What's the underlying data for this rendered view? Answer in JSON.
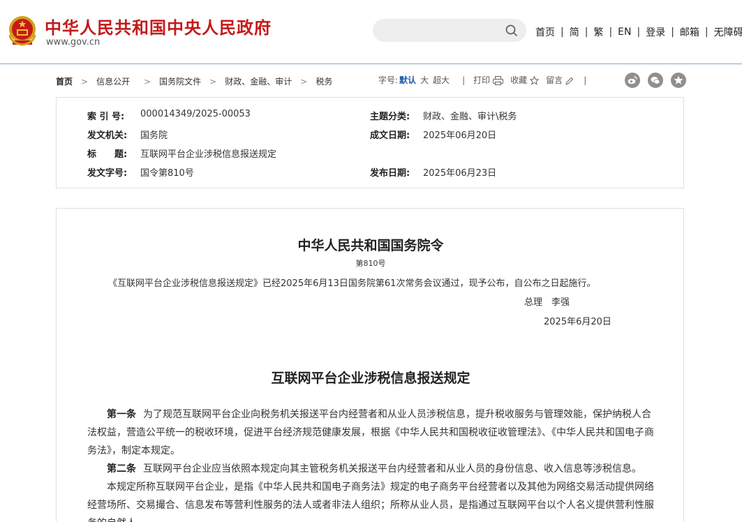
{
  "header": {
    "site_title": "中华人民共和国中央人民政府",
    "site_url": "www.gov.cn",
    "search_placeholder": "",
    "nav": [
      "首页",
      "简",
      "繁",
      "EN",
      "登录",
      "邮箱",
      "无障碍"
    ]
  },
  "breadcrumb": {
    "items": [
      "首页",
      "信息公开",
      "国务院文件",
      "财政、金融、审计",
      "税务"
    ]
  },
  "tools": {
    "font_label": "字号:",
    "font_default": "默认",
    "font_large": "大",
    "font_xlarge": "超大",
    "print": "打印",
    "favorite": "收藏",
    "comment": "留言"
  },
  "colors": {
    "brand_red": "#c41a1a",
    "link_blue": "#1d5aa8",
    "header_border": "#8aa8c0"
  },
  "meta": {
    "index_label": "索 引 号:",
    "index_value": "000014349/2025-00053",
    "topic_label": "主题分类:",
    "topic_value": "财政、金融、审计\\税务",
    "issuer_label": "发文机关:",
    "issuer_value": "国务院",
    "date_written_label": "成文日期:",
    "date_written_value": "2025年06月20日",
    "title_label": "标　　题:",
    "title_value": "互联网平台企业涉税信息报送规定",
    "doc_no_label": "发文字号:",
    "doc_no_value": "国令第810号",
    "publish_label": "发布日期:",
    "publish_value": "2025年06月23日"
  },
  "document": {
    "order_title": "中华人民共和国国务院令",
    "order_no": "第810号",
    "order_text": "《互联网平台企业涉税信息报送规定》已经2025年6月13日国务院第61次常务会议通过，现予公布，自公布之日起施行。",
    "sign_title": "总理　李强",
    "sign_date": "2025年6月20日",
    "reg_title": "互联网平台企业涉税信息报送规定",
    "art1_label": "第一条",
    "art1_text": "为了规范互联网平台企业向税务机关报送平台内经营者和从业人员涉税信息，提升税收服务与管理效能，保护纳税人合法权益，营造公平统一的税收环境，促进平台经济规范健康发展，根据《中华人民共和国税收征收管理法》、《中华人民共和国电子商务法》，制定本规定。",
    "art2_label": "第二条",
    "art2_text": "互联网平台企业应当依照本规定向其主管税务机关报送平台内经营者和从业人员的身份信息、收入信息等涉税信息。",
    "art2_p2": "本规定所称互联网平台企业，是指《中华人民共和国电子商务法》规定的电子商务平台经营者以及其他为网络交易活动提供网络经营场所、交易撮合、信息发布等营利性服务的法人或者非法人组织；所称从业人员，是指通过互联网平台以个人名义提供营利性服务的自然人。"
  }
}
